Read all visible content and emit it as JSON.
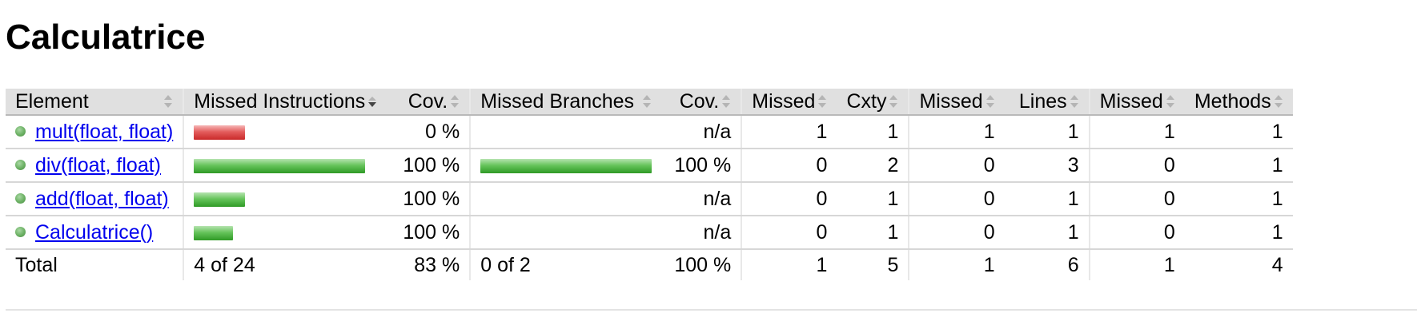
{
  "page": {
    "title": "Calculatrice"
  },
  "table": {
    "headers": {
      "element": "Element",
      "missed_instructions": "Missed Instructions",
      "cov_instructions": "Cov.",
      "missed_branches": "Missed Branches",
      "cov_branches": "Cov.",
      "missed_cxty": "Missed",
      "cxty": "Cxty",
      "missed_lines": "Missed",
      "lines": "Lines",
      "missed_methods": "Missed",
      "methods": "Methods"
    },
    "rows": [
      {
        "name": "mult(float, float)",
        "instr_bar": {
          "color": "red",
          "fraction": 0.3
        },
        "instr_cov": "0 %",
        "branch_bar": null,
        "branch_cov": "n/a",
        "missed_cxty": "1",
        "cxty": "1",
        "missed_lines": "1",
        "lines": "1",
        "missed_methods": "1",
        "methods": "1"
      },
      {
        "name": "div(float, float)",
        "instr_bar": {
          "color": "green",
          "fraction": 1.0
        },
        "instr_cov": "100 %",
        "branch_bar": {
          "color": "green",
          "fraction": 1.0
        },
        "branch_cov": "100 %",
        "missed_cxty": "0",
        "cxty": "2",
        "missed_lines": "0",
        "lines": "3",
        "missed_methods": "0",
        "methods": "1"
      },
      {
        "name": "add(float, float)",
        "instr_bar": {
          "color": "green",
          "fraction": 0.3
        },
        "instr_cov": "100 %",
        "branch_bar": null,
        "branch_cov": "n/a",
        "missed_cxty": "0",
        "cxty": "1",
        "missed_lines": "0",
        "lines": "1",
        "missed_methods": "0",
        "methods": "1"
      },
      {
        "name": "Calculatrice()",
        "instr_bar": {
          "color": "green",
          "fraction": 0.23
        },
        "instr_cov": "100 %",
        "branch_bar": null,
        "branch_cov": "n/a",
        "missed_cxty": "0",
        "cxty": "1",
        "missed_lines": "0",
        "lines": "1",
        "missed_methods": "0",
        "methods": "1"
      }
    ],
    "total": {
      "label": "Total",
      "instr": "4 of 24",
      "instr_cov": "83 %",
      "branch": "0 of 2",
      "branch_cov": "100 %",
      "missed_cxty": "1",
      "cxty": "5",
      "missed_lines": "1",
      "lines": "6",
      "missed_methods": "1",
      "methods": "4"
    }
  },
  "colors": {
    "header_bg": "#e0e0e0",
    "link": "#0000ee",
    "bar_green": "#66c45b",
    "bar_red": "#e35c5c"
  },
  "icons": {
    "sort": "sort-arrows-icon",
    "sort_desc": "sort-desc-icon",
    "bullet": "method-bullet-icon"
  }
}
